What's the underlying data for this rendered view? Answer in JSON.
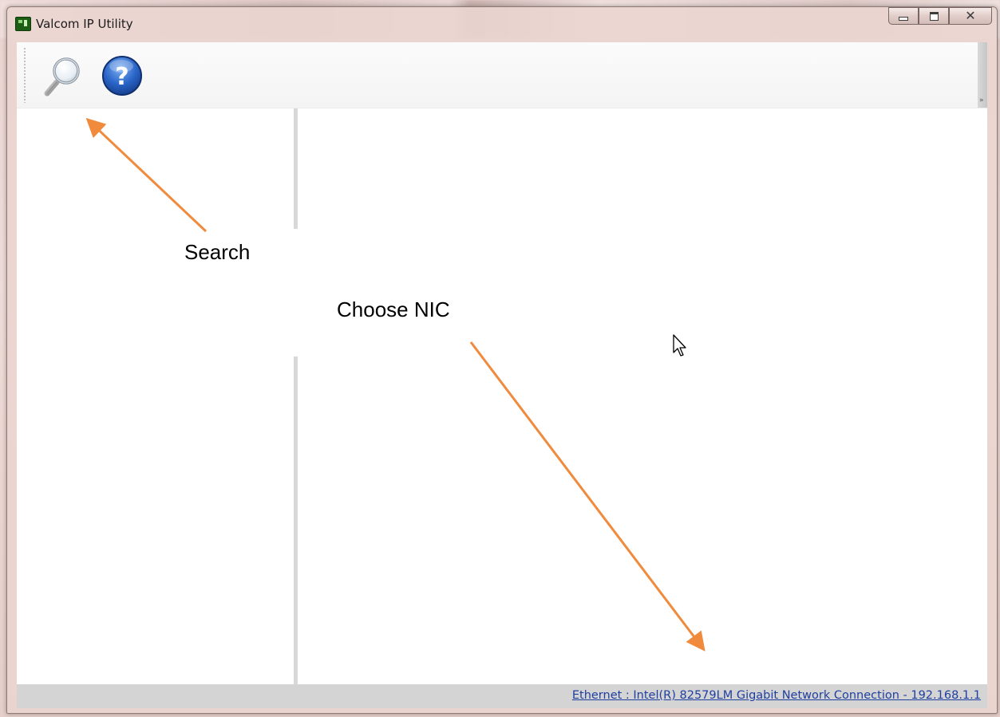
{
  "window": {
    "title": "Valcom IP Utility",
    "controls": [
      "minimize",
      "maximize",
      "close"
    ]
  },
  "toolbar": {
    "buttons": [
      {
        "name": "search",
        "icon": "magnifier-icon"
      },
      {
        "name": "help",
        "icon": "help-icon"
      }
    ]
  },
  "statusbar": {
    "nic_link": "Ethernet : Intel(R) 82579LM Gigabit Network Connection - 192.168.1.1"
  },
  "annotations": {
    "search_label": "Search",
    "nic_label": "Choose NIC",
    "arrow_color": "#f08a3c"
  },
  "colors": {
    "status_link": "#1f3fa0",
    "statusbar_bg": "#d4d4d4",
    "splitter": "#d8d8d8"
  }
}
